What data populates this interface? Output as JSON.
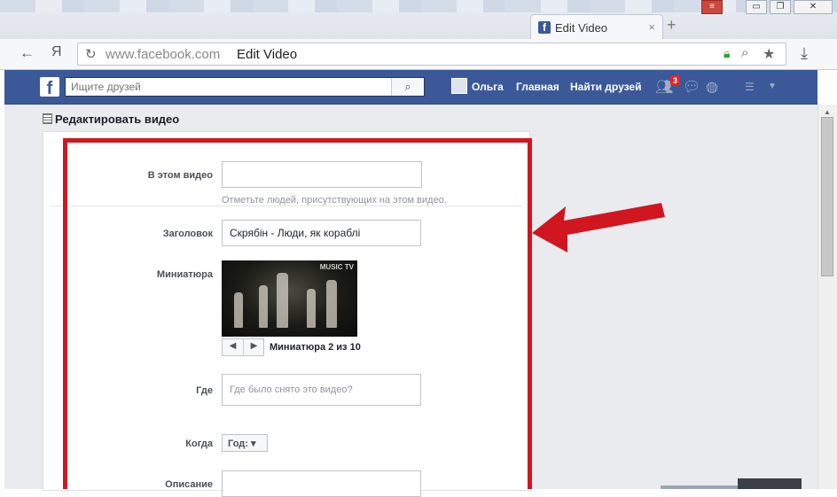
{
  "browser": {
    "tab_title": "Edit Video",
    "tab_close": "×",
    "new_tab": "+",
    "back": "←",
    "yandex": "Я",
    "reload": "↻",
    "url": "www.facebook.com",
    "page_title": "Edit Video",
    "download": "⤓",
    "win_minimize": "▭",
    "win_restore": "❐",
    "win_close": "✕",
    "win_menu": "≡"
  },
  "fb": {
    "logo": "f",
    "search_placeholder": "Ищите друзей",
    "user_name": "Ольга",
    "home": "Главная",
    "find_friends": "Найти друзей",
    "friend_requests_count": "3"
  },
  "page": {
    "title": "Редактировать видео"
  },
  "form": {
    "tagged_label": "В этом видео",
    "tagged_value": "",
    "tagged_hint": "Отметьте людей, присутствующих на этом видео.",
    "title_label": "Заголовок",
    "title_value": "Скрябін - Люди, як кораблі",
    "thumbnail_label": "Миниатюра",
    "thumbnail_watermark": "MUSIC TV",
    "thumbnail_prev": "◀",
    "thumbnail_next": "▶",
    "thumbnail_counter": "Миниатюра 2 из 10",
    "where_label": "Где",
    "where_placeholder": "Где было снято это видео?",
    "when_label": "Когда",
    "year_button": "Год: ▾",
    "description_label": "Описание"
  },
  "colors": {
    "fb_blue": "#3b5998",
    "highlight_red": "#d0161f"
  }
}
